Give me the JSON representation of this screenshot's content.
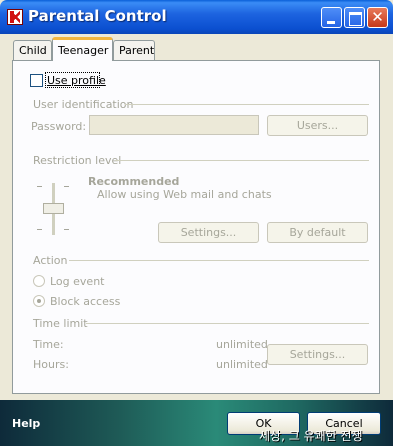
{
  "window": {
    "title": "Parental Control"
  },
  "tabs": [
    {
      "label": "Child"
    },
    {
      "label": "Teenager"
    },
    {
      "label": "Parent"
    }
  ],
  "profile": {
    "use_profile_label": "Use profile"
  },
  "user_identification": {
    "section_title": "User identification",
    "password_label": "Password:",
    "users_button": "Users..."
  },
  "restriction": {
    "section_title": "Restriction level",
    "level_name": "Recommended",
    "level_description": "Allow using Web mail and chats",
    "settings_button": "Settings...",
    "default_button": "By default"
  },
  "action": {
    "section_title": "Action",
    "log_event_label": "Log event",
    "block_access_label": "Block access"
  },
  "time_limit": {
    "section_title": "Time limit",
    "time_label": "Time:",
    "time_value": "unlimited",
    "hours_label": "Hours:",
    "hours_value": "unlimited",
    "settings_button": "Settings..."
  },
  "footer": {
    "help_label": "Help",
    "ok_button": "OK",
    "cancel_button": "Cancel",
    "watermark": "세상, 그 유쾌한 전쟁"
  }
}
